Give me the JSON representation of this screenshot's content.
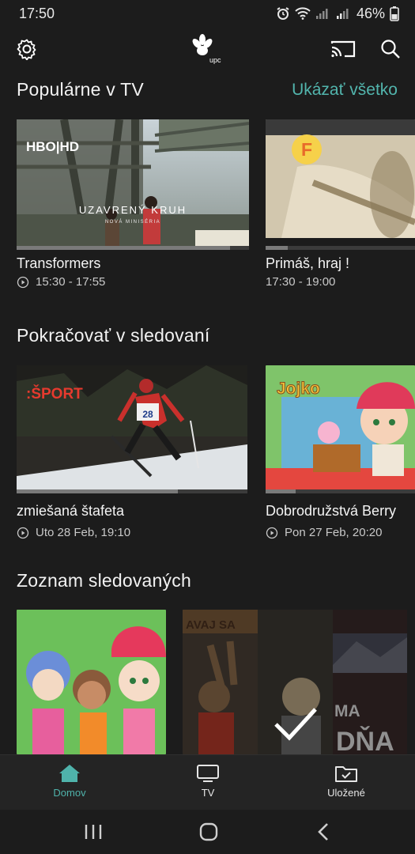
{
  "status_bar": {
    "time": "17:50",
    "battery": "46%"
  },
  "header": {
    "logo_text": "upc"
  },
  "sections": {
    "popular": {
      "title": "Populárne v TV",
      "show_all": "Ukázať všetko",
      "cards": [
        {
          "title": "Transformers",
          "time": "15:30 - 17:55",
          "overlay_channel": "HBO|HD",
          "overlay_title": "UZAVRENÝ KRUH",
          "overlay_subtitle": "NOVÁ MINISÉRIA",
          "progress": 0.92
        },
        {
          "title": "Primáš, hraj !",
          "time": "17:30 - 19:00",
          "overlay_channel": "F",
          "progress": 0.15
        }
      ]
    },
    "continue": {
      "title": "Pokračovať v sledovaní",
      "cards": [
        {
          "title": "zmiešaná štafeta",
          "time": "Uto 28 Feb, 19:10",
          "overlay_channel": ":ŠPORT",
          "overlay_badge": "28",
          "progress": 0.7
        },
        {
          "title": "Dobrodružstvá Berry",
          "time": "Pon 27 Feb, 20:20",
          "overlay_title": "Jojko",
          "progress": 0.2
        }
      ]
    },
    "watchlist": {
      "title": "Zoznam sledovaných",
      "cards": [
        {
          "overlay_text": ""
        },
        {
          "overlay_text_top": "AVAJ SA",
          "overlay_text_mid": "MA",
          "overlay_text_low": "DŇA"
        }
      ]
    }
  },
  "bottom_nav": {
    "items": [
      {
        "label": "Domov",
        "active": true
      },
      {
        "label": "TV",
        "active": false
      },
      {
        "label": "Uložené",
        "active": false
      }
    ]
  },
  "colors": {
    "accent": "#4fb3ab",
    "background": "#1c1c1c",
    "nav_background": "#242424"
  }
}
